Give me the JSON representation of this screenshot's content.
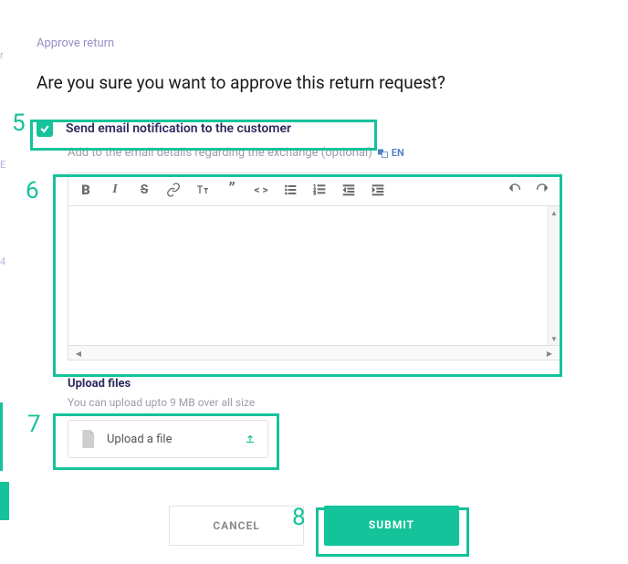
{
  "dialog": {
    "small_title": "Approve return",
    "main_title": "Are you sure you want to approve this return request?",
    "email_notify": {
      "checked": true,
      "label": "Send email notification to the customer",
      "sub_label": "Add to the email details regarding the exchange (optional)",
      "lang": "EN"
    },
    "upload": {
      "title": "Upload files",
      "desc": "You can upload upto 9 MB over all size",
      "button_label": "Upload a file"
    },
    "buttons": {
      "cancel": "CANCEL",
      "submit": "SUBMIT"
    }
  },
  "annotations": {
    "n5": "5",
    "n6": "6",
    "n7": "7",
    "n8": "8"
  }
}
